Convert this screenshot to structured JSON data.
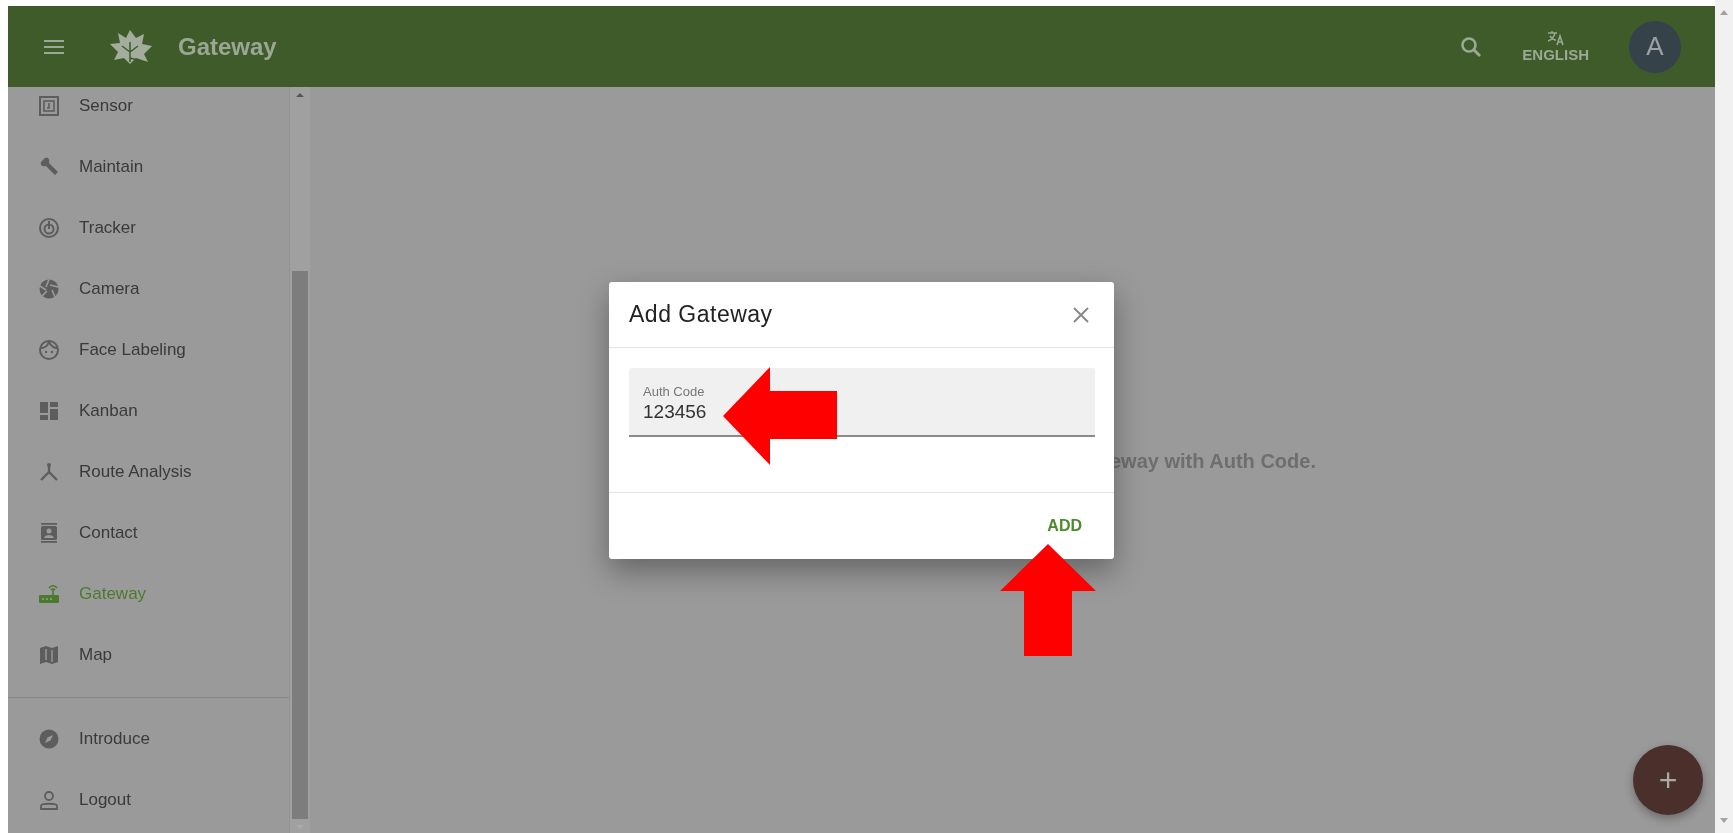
{
  "header": {
    "title": "Gateway",
    "language": "ENGLISH",
    "avatar": "A"
  },
  "sidebar": {
    "items": [
      {
        "label": "Sensor",
        "kind": "sensor",
        "selected": false
      },
      {
        "label": "Maintain",
        "kind": "wrench",
        "selected": false
      },
      {
        "label": "Tracker",
        "kind": "tracker",
        "selected": false
      },
      {
        "label": "Camera",
        "kind": "camera",
        "selected": false
      },
      {
        "label": "Face Labeling",
        "kind": "face",
        "selected": false
      },
      {
        "label": "Kanban",
        "kind": "kanban",
        "selected": false
      },
      {
        "label": "Route Analysis",
        "kind": "route",
        "selected": false
      },
      {
        "label": "Contact",
        "kind": "contact",
        "selected": false
      },
      {
        "label": "Gateway",
        "kind": "router",
        "selected": true
      },
      {
        "label": "Map",
        "kind": "map",
        "selected": false
      }
    ],
    "footer_items": [
      {
        "label": "Introduce",
        "kind": "compass",
        "selected": false
      },
      {
        "label": "Logout",
        "kind": "person",
        "selected": false
      }
    ]
  },
  "content": {
    "message": "eway with Auth Code."
  },
  "dialog": {
    "title": "Add Gateway",
    "field": {
      "label": "Auth Code",
      "value": "123456"
    },
    "buttons": [
      "ADD"
    ]
  },
  "fab": {
    "label": "+"
  },
  "annotations": [
    {
      "kind": "left_arrow"
    },
    {
      "kind": "up_arrow"
    }
  ]
}
